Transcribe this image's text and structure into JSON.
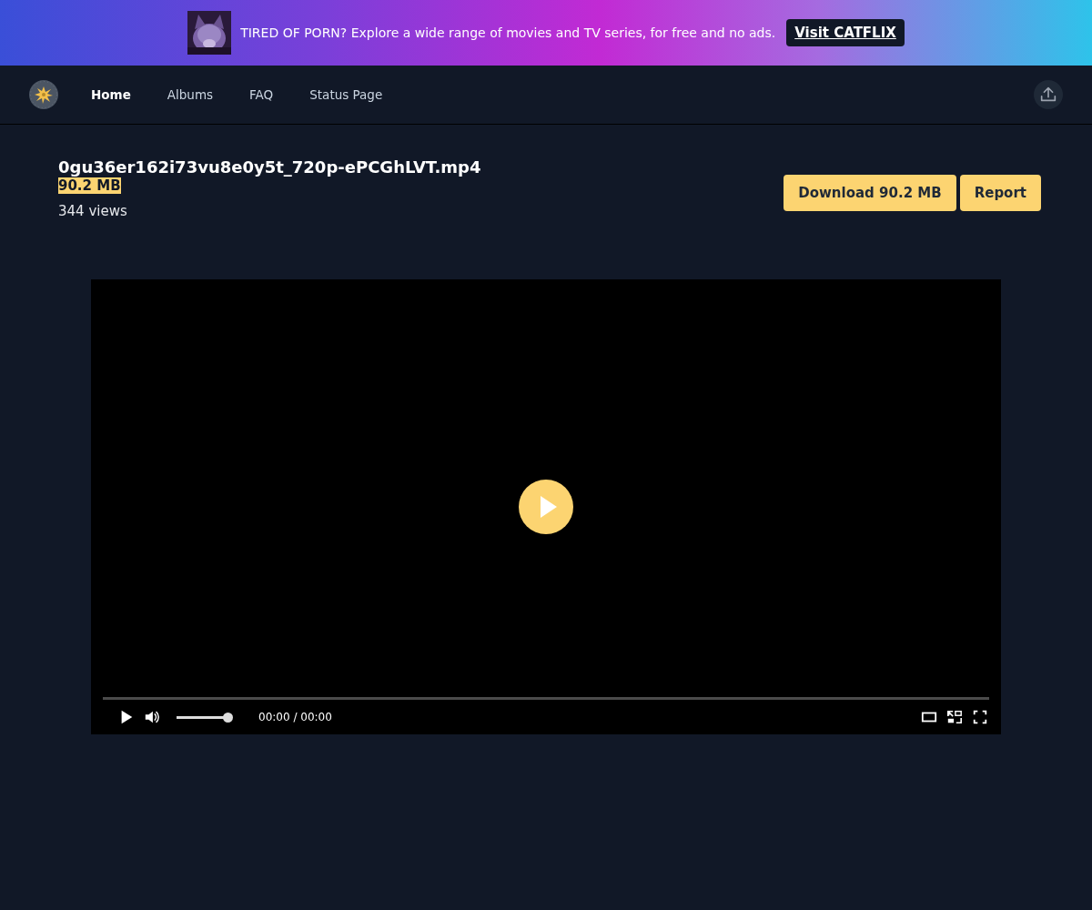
{
  "banner": {
    "text": "TIRED OF PORN? Explore a wide range of movies and TV series, for free and no ads.",
    "button": "Visit CATFLIX"
  },
  "nav": {
    "items": [
      {
        "label": "Home",
        "selected": true
      },
      {
        "label": "Albums",
        "selected": false
      },
      {
        "label": "FAQ",
        "selected": false
      },
      {
        "label": "Status Page",
        "selected": false
      }
    ]
  },
  "file": {
    "name": "0gu36er162i73vu8e0y5t_720p-ePCGhLVT.mp4",
    "size": "90.2 MB",
    "views": "344 views"
  },
  "actions": [
    "Download 90.2 MB",
    "Report"
  ],
  "player": {
    "progress": {
      "level": 0
    },
    "volume": {
      "level": 1
    },
    "time": "00:00 / 00:00"
  }
}
